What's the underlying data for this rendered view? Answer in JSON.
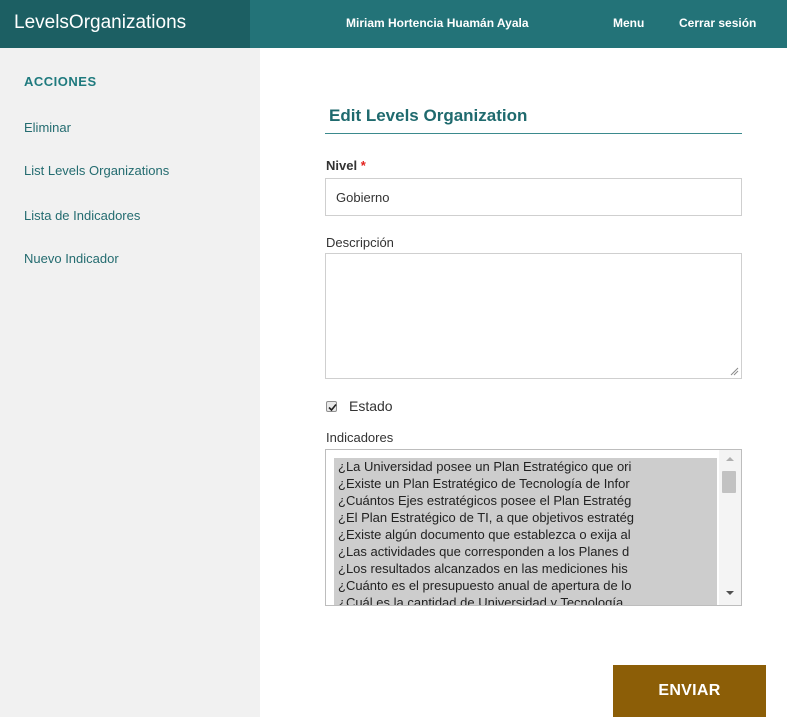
{
  "navbar": {
    "brand": "LevelsOrganizations",
    "user_name": "Miriam Hortencia Huamán Ayala",
    "menu": "Menu",
    "logout": "Cerrar sesión"
  },
  "sidebar": {
    "heading": "ACCIONES",
    "items": [
      {
        "label": "Eliminar"
      },
      {
        "label": "List Levels Organizations"
      },
      {
        "label": "Lista de Indicadores"
      },
      {
        "label": "Nuevo Indicador"
      }
    ]
  },
  "form": {
    "title": "Edit Levels Organization",
    "nivel_label": "Nivel",
    "required_mark": "*",
    "nivel_value": "Gobierno",
    "descripcion_label": "Descripción",
    "descripcion_value": "",
    "estado_label": "Estado",
    "estado_checked": true,
    "indicadores_label": "Indicadores",
    "indicadores_options": [
      "¿La Universidad posee un Plan Estratégico que ori",
      "¿Existe un Plan Estratégico de Tecnología de Infor",
      "¿Cuántos Ejes estratégicos posee el Plan Estratég",
      "¿El Plan Estratégico de TI, a que objetivos estratég",
      "¿Existe algún documento que establezca o exija al",
      "¿Las actividades que corresponden a los Planes d",
      "¿Los resultados alcanzados en las mediciones his",
      "¿Cuánto es el presupuesto anual de apertura de lo",
      "¿Cuál es la cantidad de Universidad y Tecnología"
    ],
    "submit_label": "ENVIAR"
  },
  "colors": {
    "header": "#237378",
    "brand_bg": "#1c5f63",
    "accent": "#1f6a6e",
    "submit": "#8c5e07",
    "required": "#e2211c"
  }
}
